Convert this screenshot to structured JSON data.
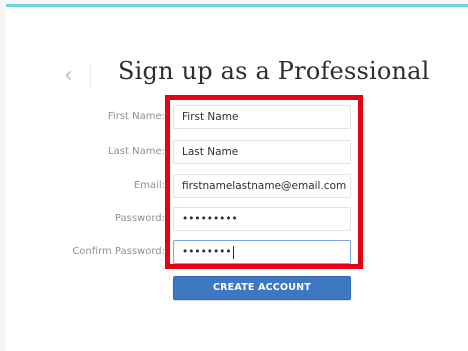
{
  "header": {
    "back_glyph": "‹",
    "title": "Sign up as a Professional"
  },
  "form": {
    "first_name": {
      "label": "First Name:",
      "value": "First Name"
    },
    "last_name": {
      "label": "Last Name:",
      "value": "Last Name"
    },
    "email": {
      "label": "Email:",
      "value": "firstnamelastname@email.com"
    },
    "password": {
      "label": "Password:",
      "value": "•••••••••"
    },
    "confirm_password": {
      "label": "Confirm Password:",
      "value": "••••••••"
    }
  },
  "actions": {
    "create_account_label": "CREATE ACCOUNT"
  },
  "colors": {
    "accent_top_border": "#6fd3d9",
    "highlight_box": "#e60012",
    "button": "#3f78c2"
  }
}
